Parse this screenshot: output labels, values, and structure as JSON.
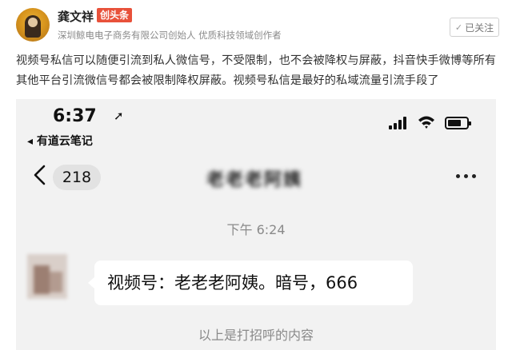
{
  "author": {
    "name": "龚文祥",
    "badge": "创头条",
    "description": "深圳鲸电电子商务有限公司创始人 优质科技领域创作者",
    "follow_label": "已关注",
    "follow_icon": "check-icon"
  },
  "post": {
    "text": "视频号私信可以随便引流到私人微信号，不受限制，也不会被降权与屏蔽，抖音快手微博等所有其他平台引流微信号都会被限制降权屏蔽。视频号私信是最好的私域流量引流手段了"
  },
  "phone": {
    "status_time": "6:37",
    "status_arrow": "➚",
    "back_app": "◂ 有道云笔记",
    "unread_count": "218",
    "chat_title": "老老老阿姨",
    "timestamp": "下午 6:24",
    "message": "视频号：老老老阿姨。暗号，666",
    "hint": "以上是打招呼的内容"
  },
  "colors": {
    "badge": "#e8513a",
    "phone_bg": "#f2f2f2",
    "bubble": "#ffffff"
  }
}
